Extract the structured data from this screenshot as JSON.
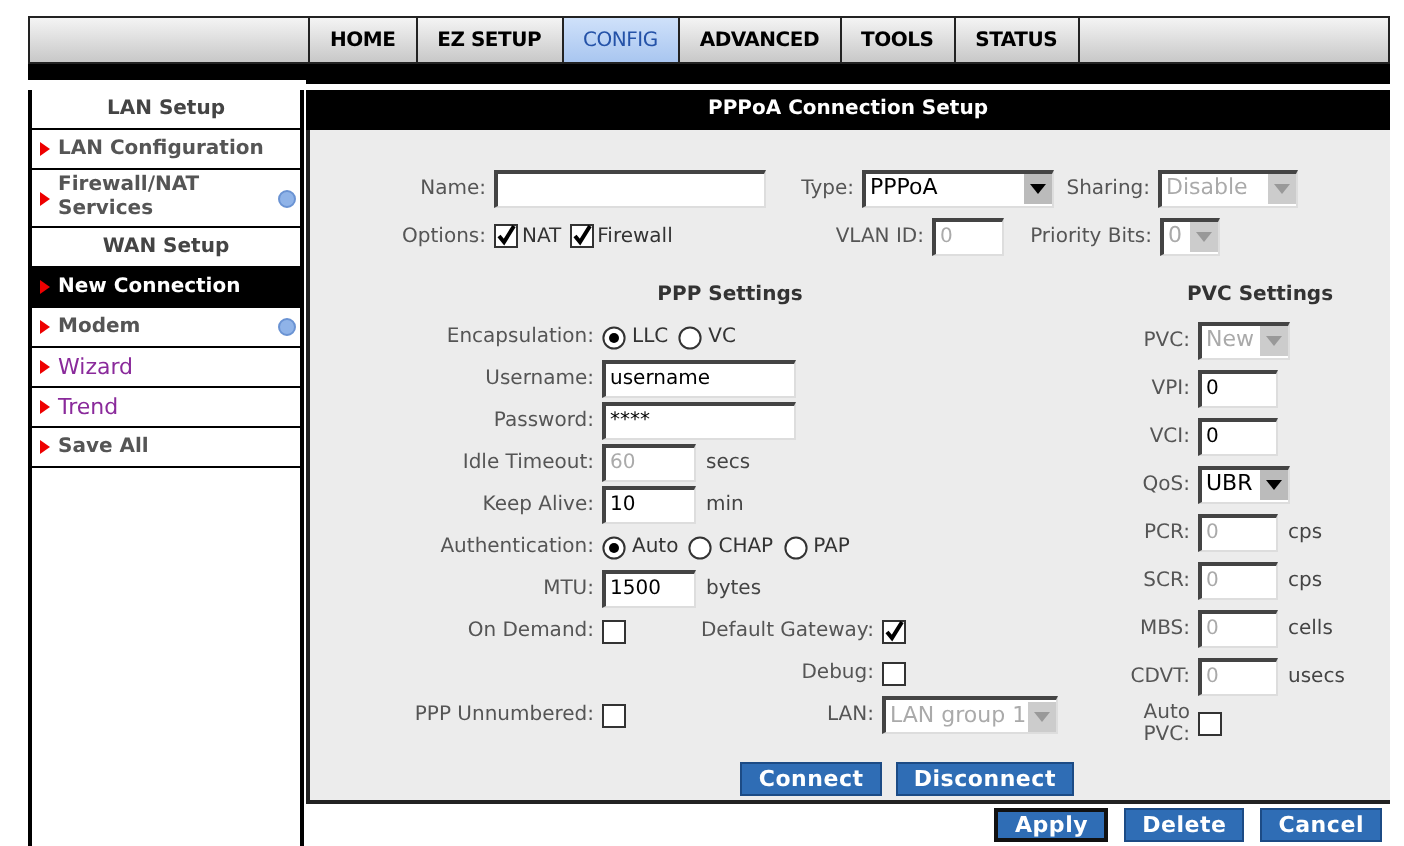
{
  "nav": {
    "tabs": [
      {
        "label": "HOME",
        "selected": false
      },
      {
        "label": "EZ SETUP",
        "selected": false
      },
      {
        "label": "CONFIG",
        "selected": true
      },
      {
        "label": "ADVANCED",
        "selected": false
      },
      {
        "label": "TOOLS",
        "selected": false
      },
      {
        "label": "STATUS",
        "selected": false
      }
    ]
  },
  "sidebar": {
    "items": [
      {
        "kind": "header",
        "label": "LAN Setup"
      },
      {
        "kind": "link",
        "label": "LAN Configuration",
        "selected": false,
        "visited": false,
        "has_submenu": false
      },
      {
        "kind": "link",
        "label": "Firewall/NAT Services",
        "selected": false,
        "visited": false,
        "has_submenu": true
      },
      {
        "kind": "header",
        "label": "WAN Setup"
      },
      {
        "kind": "link",
        "label": "New Connection",
        "selected": true,
        "visited": false,
        "has_submenu": false
      },
      {
        "kind": "link",
        "label": "Modem",
        "selected": false,
        "visited": false,
        "has_submenu": true
      },
      {
        "kind": "link",
        "label": "Wizard",
        "selected": false,
        "visited": true,
        "has_submenu": false
      },
      {
        "kind": "link",
        "label": "Trend",
        "selected": false,
        "visited": true,
        "has_submenu": false
      },
      {
        "kind": "link",
        "label": "Save All",
        "selected": false,
        "visited": false,
        "has_submenu": false
      }
    ]
  },
  "panel": {
    "title": "PPPoA Connection Setup",
    "name": {
      "label": "Name:"
    },
    "type": {
      "label": "Type:",
      "value": "PPPoA",
      "disabled": false
    },
    "sharing": {
      "label": "Sharing:",
      "value": "Disable",
      "disabled": true
    },
    "options": {
      "label": "Options:",
      "items": [
        {
          "label": "NAT",
          "checked": true
        },
        {
          "label": "Firewall",
          "checked": true
        }
      ]
    },
    "vlan_id": {
      "label": "VLAN ID:",
      "value": "0",
      "disabled": true
    },
    "priority_bits": {
      "label": "Priority Bits:",
      "value": "0",
      "disabled": true
    },
    "ppp": {
      "title": "PPP Settings",
      "fields": [
        {
          "kind": "radio",
          "label": "Encapsulation:",
          "options": [
            {
              "label": "LLC",
              "selected": true
            },
            {
              "label": "VC",
              "selected": false
            }
          ]
        },
        {
          "kind": "text",
          "label": "Username:",
          "value": "username",
          "disabled": false
        },
        {
          "kind": "text",
          "label": "Password:",
          "value": "****",
          "disabled": false
        },
        {
          "kind": "text",
          "label": "Idle Timeout:",
          "value": "60",
          "unit": "secs",
          "disabled": true
        },
        {
          "kind": "text",
          "label": "Keep Alive:",
          "value": "10",
          "unit": "min",
          "disabled": false
        },
        {
          "kind": "radio",
          "label": "Authentication:",
          "options": [
            {
              "label": "Auto",
              "selected": true
            },
            {
              "label": "CHAP",
              "selected": false
            },
            {
              "label": "PAP",
              "selected": false
            }
          ]
        },
        {
          "kind": "text",
          "label": "MTU:",
          "value": "1500",
          "unit": "bytes",
          "disabled": false
        }
      ],
      "on_demand": {
        "label": "On Demand:",
        "checked": false
      },
      "default_gateway": {
        "label": "Default Gateway:",
        "checked": true
      },
      "debug": {
        "label": "Debug:",
        "checked": false
      },
      "ppp_unnumbered": {
        "label": "PPP Unnumbered:",
        "checked": false
      },
      "lan": {
        "label": "LAN:",
        "value": "LAN group 1",
        "disabled": true
      },
      "buttons": [
        "Connect",
        "Disconnect"
      ]
    },
    "pvc": {
      "title": "PVC Settings",
      "fields": [
        {
          "kind": "select",
          "label": "PVC:",
          "value": "New",
          "disabled": true
        },
        {
          "kind": "text",
          "label": "VPI:",
          "value": "0",
          "disabled": false
        },
        {
          "kind": "text",
          "label": "VCI:",
          "value": "0",
          "disabled": false
        },
        {
          "kind": "select",
          "label": "QoS:",
          "value": "UBR",
          "disabled": false
        },
        {
          "kind": "text",
          "label": "PCR:",
          "value": "0",
          "unit": "cps",
          "disabled": true
        },
        {
          "kind": "text",
          "label": "SCR:",
          "value": "0",
          "unit": "cps",
          "disabled": true
        },
        {
          "kind": "text",
          "label": "MBS:",
          "value": "0",
          "unit": "cells",
          "disabled": true
        },
        {
          "kind": "text",
          "label": "CDVT:",
          "value": "0",
          "unit": "usecs",
          "disabled": true
        },
        {
          "kind": "checkbox",
          "label": "Auto PVC:",
          "checked": false
        }
      ]
    }
  },
  "footer": {
    "buttons": [
      {
        "label": "Apply",
        "default": true
      },
      {
        "label": "Delete",
        "default": false
      },
      {
        "label": "Cancel",
        "default": false
      }
    ]
  }
}
